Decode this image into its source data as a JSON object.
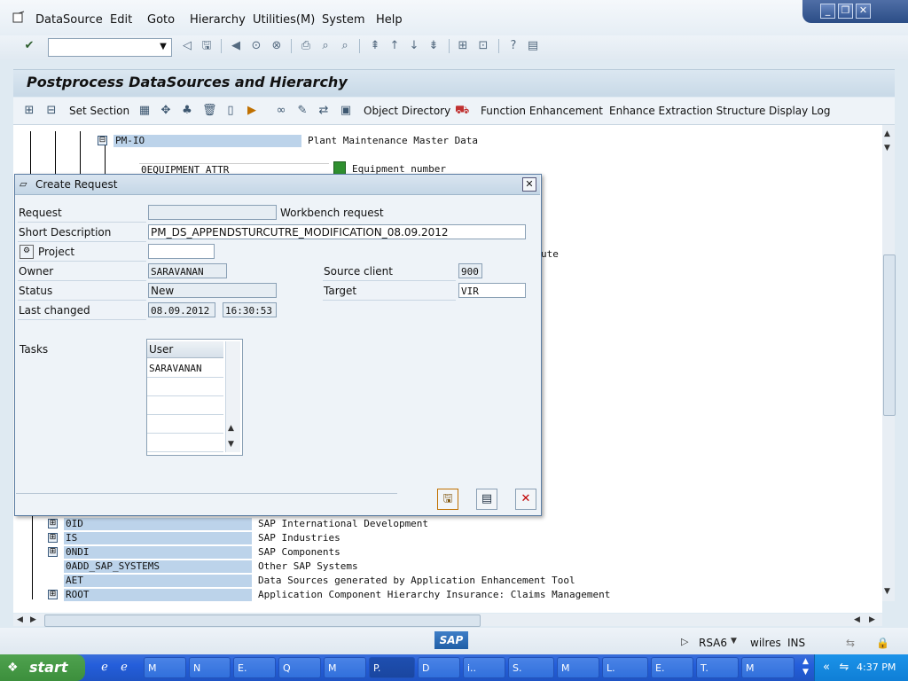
{
  "menu": {
    "items": [
      "DataSource",
      "Edit",
      "Goto",
      "Hierarchy",
      "Utilities(M)",
      "System",
      "Help"
    ]
  },
  "window_controls": {
    "minimize": "_",
    "restore": "❐",
    "close": "✕"
  },
  "screen": {
    "title": "Postprocess DataSources and Hierarchy",
    "toolbar": {
      "set_section": "Set Section",
      "object_directory": "Object Directory",
      "function_enhancement": "Function Enhancement",
      "enhance_extraction_structure": "Enhance Extraction Structure",
      "display_log": "Display Log"
    }
  },
  "tree": {
    "top_nodes": [
      {
        "key": "PM-IO",
        "desc": "Plant Maintenance Master Data",
        "expander": "⊟"
      },
      {
        "key": "0EQUIPMENT_ATTR",
        "desc": "Equipment number"
      }
    ],
    "partial_text": "ute",
    "bottom_nodes": [
      {
        "key": "0ID",
        "desc": "SAP International Development",
        "expander": "⊞"
      },
      {
        "key": "IS",
        "desc": "SAP Industries",
        "expander": "⊞"
      },
      {
        "key": "0NDI",
        "desc": "SAP Components",
        "expander": "⊞"
      },
      {
        "key": "0ADD_SAP_SYSTEMS",
        "desc": "Other SAP Systems"
      },
      {
        "key": "AET",
        "desc": "Data Sources generated by Application Enhancement Tool"
      },
      {
        "key": "ROOT",
        "desc": "Application Component Hierarchy Insurance: Claims Management",
        "expander": "⊞"
      }
    ]
  },
  "dialog": {
    "title": "Create Request",
    "request_label": "Request",
    "request_value": "",
    "request_type": "Workbench request",
    "short_desc_label": "Short Description",
    "short_desc_value": "PM_DS_APPENDSTURCUTRE_MODIFICATION_08.09.2012",
    "project_label": "Project",
    "project_value": "",
    "owner_label": "Owner",
    "owner_value": "SARAVANAN",
    "status_label": "Status",
    "status_value": "New",
    "last_changed_label": "Last changed",
    "last_changed_date": "08.09.2012",
    "last_changed_time": "16:30:53",
    "source_client_label": "Source client",
    "source_client_value": "900",
    "target_label": "Target",
    "target_value": "VIR",
    "tasks_label": "Tasks",
    "tasks_col": "User",
    "tasks_rows": [
      "SARAVANAN",
      "",
      "",
      "",
      ""
    ]
  },
  "status_bar": {
    "logo": "SAP",
    "system": "RSA6",
    "server": "wilres",
    "mode": "INS"
  },
  "taskbar": {
    "start_label": "start",
    "buttons": [
      "M",
      "N",
      "E.",
      "Q",
      "M",
      "P.",
      "D",
      "i..",
      "S.",
      "M",
      "L.",
      "E.",
      "T.",
      "M"
    ],
    "active_index": 5,
    "clock": "4:37 PM"
  }
}
